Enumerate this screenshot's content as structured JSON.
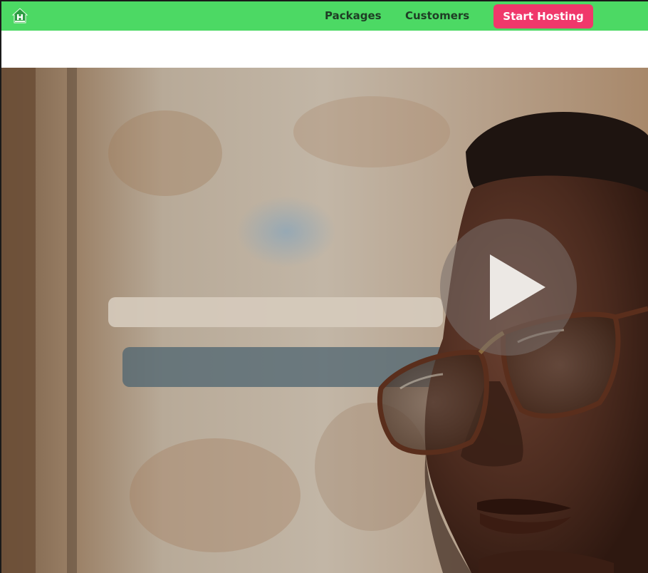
{
  "nav": {
    "logo_icon": "house-logo-icon",
    "links": [
      {
        "label": "Packages"
      },
      {
        "label": "Customers"
      }
    ],
    "cta_label": "Start Hosting"
  },
  "hero": {
    "media": "video-thumbnail-man-with-glasses",
    "play_icon": "play-icon"
  },
  "colors": {
    "nav_bg": "#4cd964",
    "nav_text": "#1f3d25",
    "cta_bg": "#f0386b",
    "cta_text": "#ffffff"
  }
}
